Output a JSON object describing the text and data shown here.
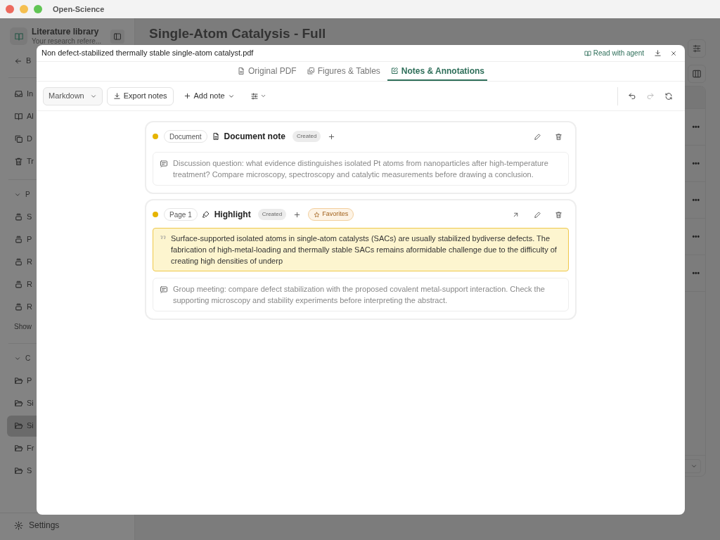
{
  "app": {
    "title": "Open-Science"
  },
  "sidebar": {
    "title": "Literature library",
    "subtitle": "Your research refere...",
    "back": "B",
    "nav": [
      {
        "kind": "inbox",
        "label": "In",
        "selected": false
      },
      {
        "kind": "book",
        "label": "Al",
        "selected": false
      },
      {
        "kind": "copy",
        "label": "D",
        "selected": false
      },
      {
        "kind": "trash",
        "label": "Tr",
        "selected": false
      }
    ],
    "sections": [
      {
        "heading": "P",
        "expanded": true,
        "more": "Show",
        "items": [
          {
            "kind": "stack",
            "label": "S",
            "selected": false
          },
          {
            "kind": "stack",
            "label": "P",
            "selected": false
          },
          {
            "kind": "stack",
            "label": "R",
            "selected": false
          },
          {
            "kind": "stack",
            "label": "R",
            "selected": false
          },
          {
            "kind": "stack",
            "label": "R",
            "selected": false
          }
        ]
      },
      {
        "heading": "C",
        "expanded": true,
        "items": [
          {
            "kind": "folder",
            "label": "P",
            "selected": false
          },
          {
            "kind": "folder",
            "label": "Si",
            "selected": false
          },
          {
            "kind": "folder",
            "label": "Si",
            "selected": true
          },
          {
            "kind": "folder",
            "label": "Fr",
            "selected": false
          },
          {
            "kind": "folder",
            "label": "S",
            "selected": false
          }
        ]
      }
    ],
    "settings": "Settings"
  },
  "main": {
    "title": "Single-Atom Catalysis - Full",
    "row_menus": [
      "•••",
      "•••",
      "•••",
      "•••",
      "•••"
    ]
  },
  "dialog": {
    "file_name": "Non defect-stabilized thermally stable single-atom catalyst.pdf",
    "agent_link": "Read with agent",
    "tabs": [
      {
        "kind": "file",
        "label": "Original PDF",
        "selected": false
      },
      {
        "kind": "images",
        "label": "Figures & Tables",
        "selected": false
      },
      {
        "kind": "note",
        "label": "Notes & Annotations",
        "selected": true
      }
    ],
    "toolbar": {
      "format": "Markdown",
      "export": "Export notes",
      "add": "Add note",
      "actions": [
        {
          "kind": "undo",
          "disabled": false
        },
        {
          "kind": "redo",
          "disabled": true
        },
        {
          "kind": "refresh",
          "disabled": false
        }
      ]
    },
    "notes": [
      {
        "kind": "document",
        "location": "Document",
        "title": "Document note",
        "status": "Created",
        "comment": "Discussion question: what evidence distinguishes isolated Pt atoms from nanoparticles after high-temperature treatment? Compare microscopy, spectroscopy and catalytic measurements before drawing a conclusion."
      },
      {
        "kind": "highlight",
        "location": "Page 1",
        "title": "Highlight",
        "status": "Created",
        "tags": [
          "Favorites"
        ],
        "quote": "Surface-supported isolated atoms in single-atom catalysts (SACs) are usually stabilized bydiverse defects. The fabrication of high-metal-loading and thermally stable SACs remains aformidable challenge due to the difficulty of creating high densities of underp",
        "comment": "Group meeting: compare defect stabilization with the proposed covalent metal-support interaction. Check the supporting microscopy and stability experiments before interpreting the abstract."
      }
    ]
  }
}
